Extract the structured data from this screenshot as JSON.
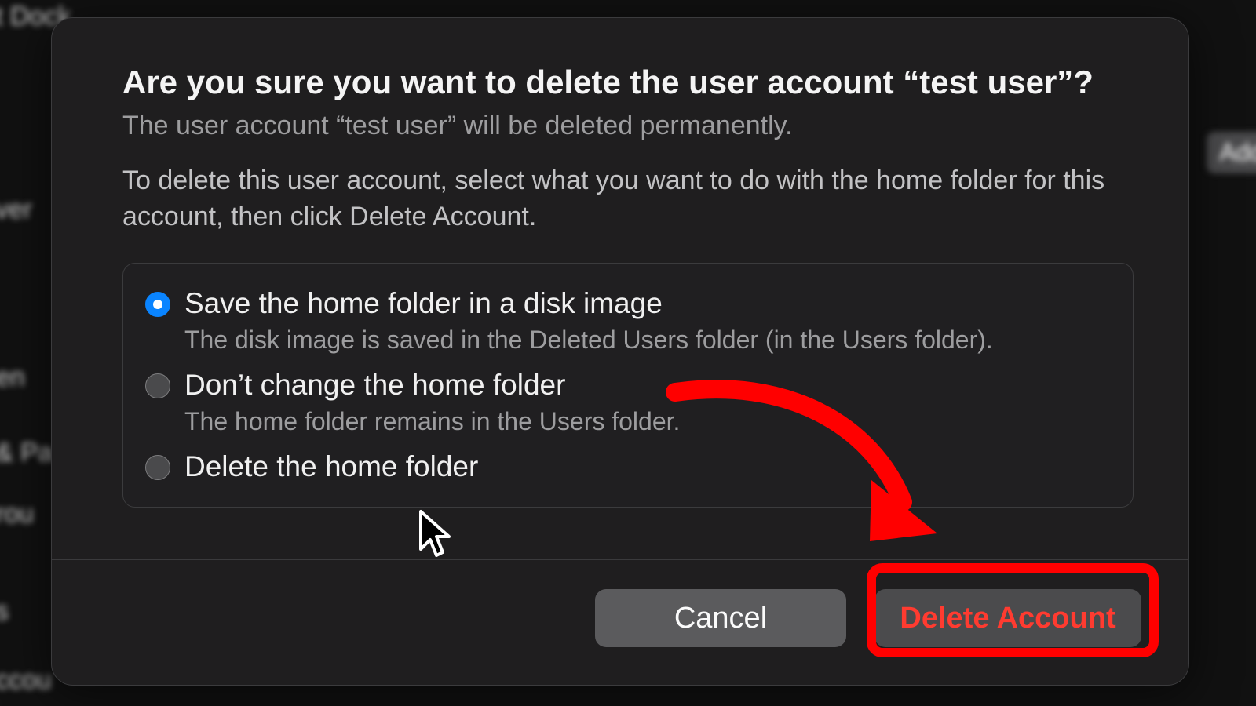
{
  "background": {
    "top_left": "t Dock",
    "side1": "ver",
    "side2": "en",
    "side3": "& Pa",
    "side4": "rou",
    "side5": "s",
    "side6": "ccou",
    "right_button": "Add"
  },
  "dialog": {
    "title": "Are you sure you want to delete the user account “test user”?",
    "subtitle": "The user account “test user” will be deleted permanently.",
    "body": "To delete this user account, select what you want to do with the home folder for this account, then click Delete Account.",
    "options": [
      {
        "label": "Save the home folder in a disk image",
        "desc": "The disk image is saved in the Deleted Users folder (in the Users folder).",
        "selected": true
      },
      {
        "label": "Don’t change the home folder",
        "desc": "The home folder remains in the Users folder.",
        "selected": false
      },
      {
        "label": "Delete the home folder",
        "desc": "",
        "selected": false
      }
    ],
    "buttons": {
      "cancel": "Cancel",
      "delete": "Delete Account"
    }
  },
  "annotation": {
    "highlight_color": "#ff0000",
    "target": "delete-account-button"
  }
}
